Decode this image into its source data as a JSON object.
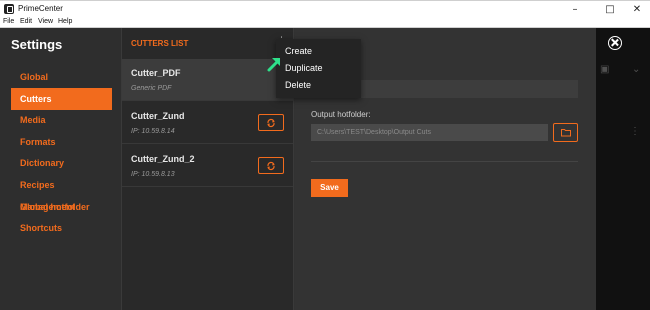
{
  "window": {
    "title": "PrimeCenter"
  },
  "menubar": {
    "items": [
      "File",
      "Edit",
      "View",
      "Help"
    ]
  },
  "settings": {
    "title": "Settings",
    "nav": [
      {
        "label": "Global",
        "active": false
      },
      {
        "label": "Cutters",
        "active": true
      },
      {
        "label": "Media",
        "active": false
      },
      {
        "label": "Formats",
        "active": false
      },
      {
        "label": "Dictionary",
        "active": false
      },
      {
        "label": "Recipes Management",
        "active": false
      },
      {
        "label": "Global hotfolder",
        "active": false
      },
      {
        "label": "Shortcuts",
        "active": false
      }
    ]
  },
  "cutters": {
    "header": "CUTTERS LIST",
    "items": [
      {
        "name": "Cutter_PDF",
        "sub": "Generic PDF",
        "selected": true
      },
      {
        "name": "Cutter_Zund",
        "sub": "IP: 10.59.8.14",
        "selected": false
      },
      {
        "name": "Cutter_Zund_2",
        "sub": "IP: 10.59.8.13",
        "selected": false
      }
    ]
  },
  "context_menu": {
    "items": [
      "Create",
      "Duplicate",
      "Delete"
    ]
  },
  "detail": {
    "output_label": "Output hotfolder:",
    "output_value": "C:\\Users\\TEST\\Desktop\\Output Cuts",
    "save_label": "Save"
  },
  "colors": {
    "accent": "#f26b1d",
    "panel": "#323232",
    "list": "#292929",
    "pointer": "#2ee08a"
  }
}
